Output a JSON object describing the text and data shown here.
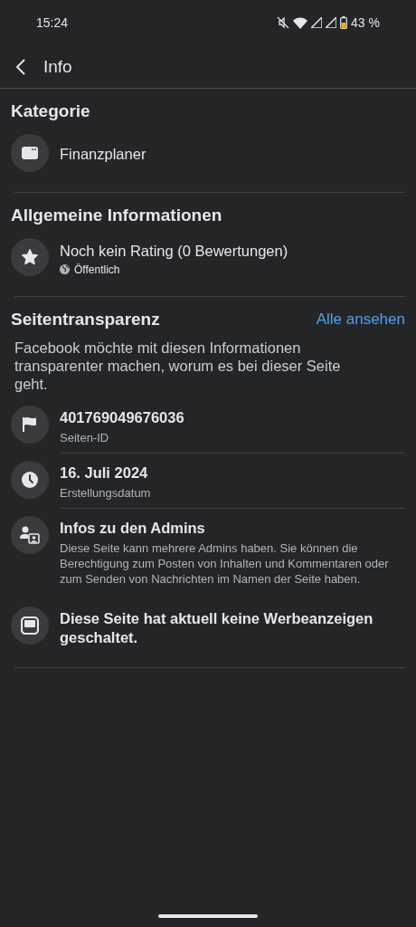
{
  "status_bar": {
    "time": "15:24",
    "battery": "43 %"
  },
  "header": {
    "title": "Info"
  },
  "sections": [
    {
      "title": "Kategorie",
      "items": [
        {
          "kind": "category",
          "title": "Finanzplaner"
        }
      ]
    },
    {
      "title": "Allgemeine Informationen",
      "items": [
        {
          "kind": "star",
          "title": "Noch kein Rating (0 Bewertungen)",
          "audience": "Öffentlich"
        }
      ]
    },
    {
      "title": "Seitentransparenz",
      "link": "Alle ansehen",
      "description": "Facebook möchte mit diesen Informationen transparenter machen, worum es bei dieser Seite geht.",
      "items": [
        {
          "kind": "flag",
          "title": "401769049676036",
          "subtitle": "Seiten-ID"
        },
        {
          "kind": "clock",
          "title": "16. Juli 2024",
          "subtitle": "Erstellungsdatum"
        },
        {
          "kind": "admins",
          "title": "Infos zu den Admins",
          "subtitle": "Diese Seite kann mehrere Admins haben. Sie können die Berechtigung zum Posten von Inhalten und Kommentaren oder zum Senden von Nachrichten im Namen der Seite haben."
        },
        {
          "kind": "ads",
          "title": "Diese Seite hat aktuell keine Werbeanzeigen geschaltet."
        }
      ]
    }
  ]
}
